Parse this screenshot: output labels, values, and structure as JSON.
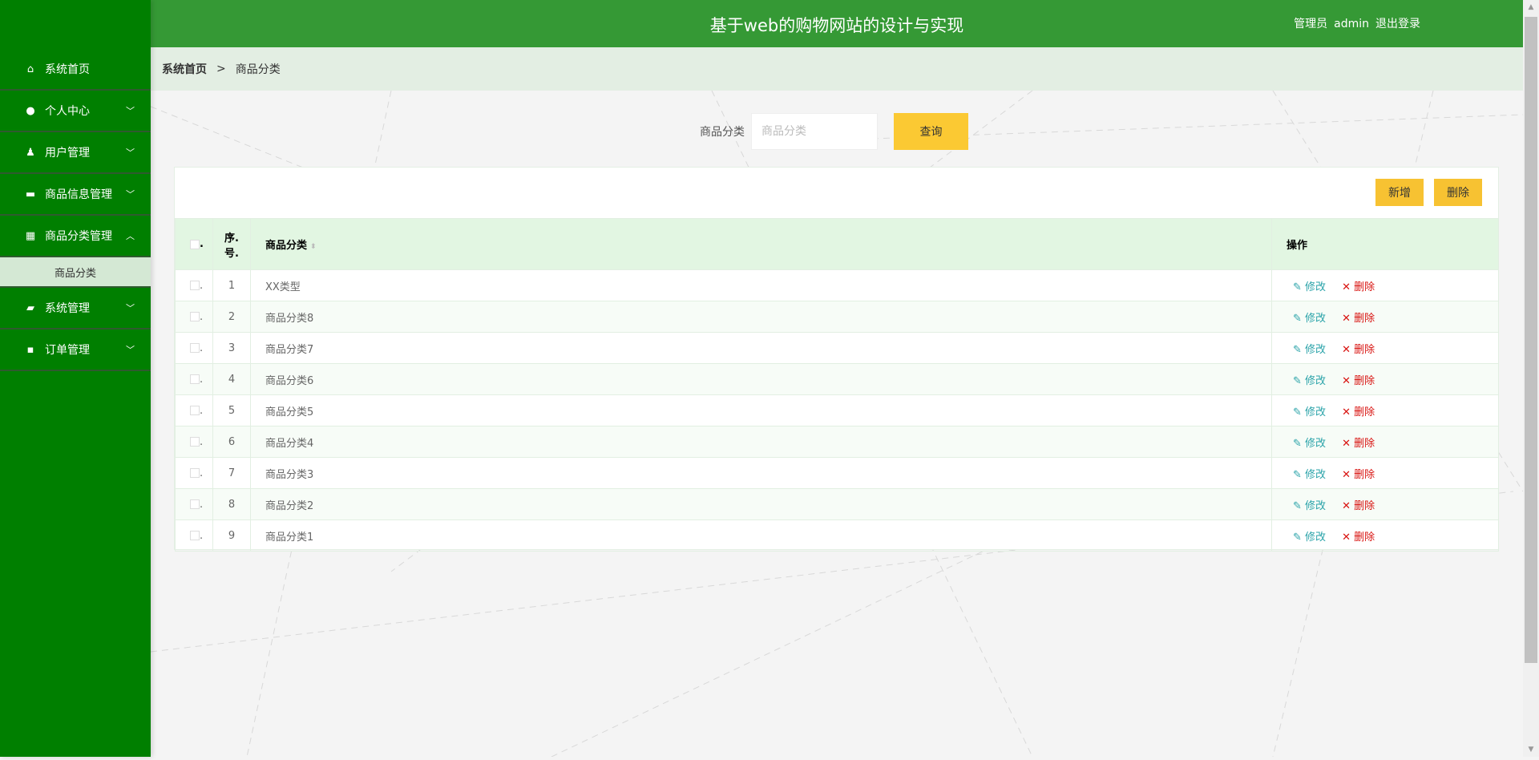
{
  "header": {
    "title": "基于web的购物网站的设计与实现",
    "role": "管理员",
    "username": "admin",
    "logout": "退出登录"
  },
  "sidebar": {
    "items": [
      {
        "label": "系统首页",
        "icon": "home-icon"
      },
      {
        "label": "个人中心",
        "icon": "user-icon"
      },
      {
        "label": "用户管理",
        "icon": "users-icon"
      },
      {
        "label": "商品信息管理",
        "icon": "ticket-icon"
      },
      {
        "label": "商品分类管理",
        "icon": "grid-icon"
      },
      {
        "label": "系统管理",
        "icon": "briefcase-icon"
      },
      {
        "label": "订单管理",
        "icon": "chat-icon"
      }
    ],
    "submenu": {
      "label": "商品分类"
    }
  },
  "breadcrumb": {
    "home": "系统首页",
    "separator": ">",
    "current": "商品分类"
  },
  "search": {
    "label": "商品分类",
    "placeholder": "商品分类",
    "value": "",
    "button": "查询"
  },
  "toolbar": {
    "add": "新增",
    "delete": "删除"
  },
  "table": {
    "headers": {
      "index": "序.号.",
      "name": "商品分类",
      "actions": "操作"
    },
    "rows": [
      {
        "index": "1",
        "name": "XX类型"
      },
      {
        "index": "2",
        "name": "商品分类8"
      },
      {
        "index": "3",
        "name": "商品分类7"
      },
      {
        "index": "4",
        "name": "商品分类6"
      },
      {
        "index": "5",
        "name": "商品分类5"
      },
      {
        "index": "6",
        "name": "商品分类4"
      },
      {
        "index": "7",
        "name": "商品分类3"
      },
      {
        "index": "8",
        "name": "商品分类2"
      },
      {
        "index": "9",
        "name": "商品分类1"
      }
    ],
    "edit_label": "修改",
    "delete_label": "删除"
  }
}
